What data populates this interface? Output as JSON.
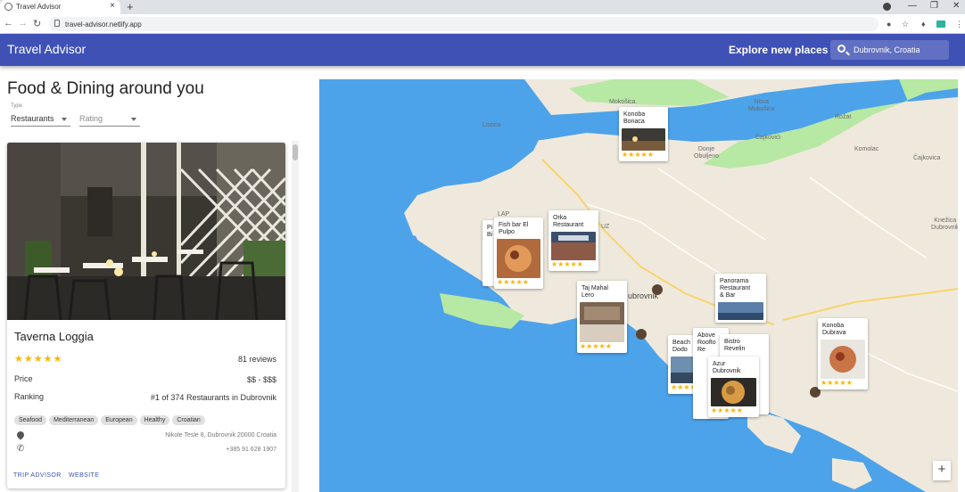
{
  "browser": {
    "tab_title": "Travel Advisor",
    "url": "travel-advisor.netlify.app",
    "new_tab": "+",
    "close_tab": "×"
  },
  "appbar": {
    "brand": "Travel Advisor",
    "explore": "Explore new places",
    "search_value": "Dubrovnik, Croatia"
  },
  "panel": {
    "heading": "Food & Dining around you",
    "type_label": "Type",
    "type_value": "Restaurants",
    "rating_placeholder": "Rating"
  },
  "card": {
    "name": "Taverna Loggia",
    "stars": "★★★★★",
    "reviews": "81 reviews",
    "rating": 5,
    "price_label": "Price",
    "price_value": "$$ - $$$",
    "ranking_label": "Ranking",
    "ranking_value": "#1 of 374 Restaurants in Dubrovnik",
    "tags": [
      "Seafood",
      "Mediterranean",
      "European",
      "Healthy",
      "Croatian"
    ],
    "address": "Nikole Tesle 8, Dubrovnik 20000 Croatia",
    "phone": "+385 91 628 1907",
    "trip_advisor": "TRIP ADVISOR",
    "website": "WEBSITE"
  },
  "map": {
    "labels": {
      "mokosica": "Mokošica",
      "nova_mokosica": "Nova\nMokošica",
      "rozat": "Rožat",
      "cajkovici": "Čajkovići",
      "komolac": "Komolac",
      "cajkovica": "Čajkovica",
      "donje_obuljeno": "Donje\nObuljeno",
      "lozica": "Lozica",
      "knezica": "Knežica\nDubrovnik",
      "dubrovnik": "ubrovnik",
      "uz": "UZ",
      "lap": "LAP",
      "mo": "MO"
    },
    "cards": {
      "konoba_bonaca": "Konoba\nBonaca",
      "fish_bar": "Fish bar El\nPulpo",
      "orka": "Orka\nRestaurant",
      "taj_mahal": "Taj Mahal\nLero",
      "panorama": "Panorama\nRestaurant\n& Bar",
      "konoba_dubrava": "Konoba\nDubrava",
      "beach_dodo": "Beach\nDodo",
      "above": "Above\nRoofto\nRe",
      "bistro": "Bistro\nRevelin",
      "azur": "Azur\nDubrovnik",
      "pi": "Pi\nBi"
    },
    "card_stars": "★★★★★",
    "zoom_in": "+"
  },
  "colors": {
    "primary": "#3f51b5",
    "star": "#fbb400",
    "water": "#4ca3ea",
    "land": "#efe9dd",
    "park": "#b7e8a4"
  }
}
